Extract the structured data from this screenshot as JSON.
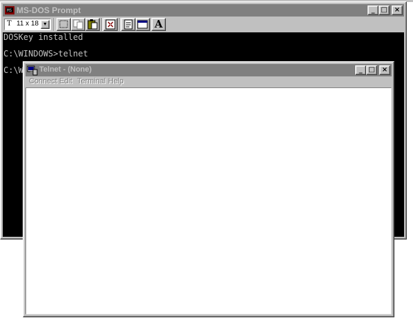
{
  "dos_window": {
    "title": "MS-DOS Prompt",
    "font_size_value": "11 x 18",
    "font_prefix": "T",
    "font_button_label": "A",
    "console_lines": [
      "DOSKey installed",
      "",
      "C:\\WINDOWS>telnet",
      "",
      "C:\\W"
    ],
    "toolbar_buttons": [
      "mark-icon",
      "copy-icon",
      "paste-icon",
      "fullscreen-icon",
      "properties-icon",
      "background-icon",
      "font-icon"
    ]
  },
  "telnet_window": {
    "title": "Telnet - (None)",
    "menu": [
      "Connect",
      "Edit",
      "Terminal",
      "Help"
    ]
  },
  "titlebar_buttons": {
    "minimize": "_",
    "maximize": "□",
    "close": "×"
  },
  "colors": {
    "inactive_titlebar": "#808080",
    "console_bg": "#000000",
    "console_fg": "#c0c0c0",
    "face": "#c0c0c0"
  }
}
